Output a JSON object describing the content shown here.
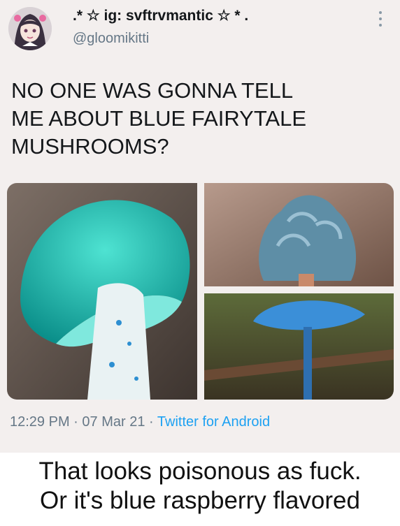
{
  "tweet": {
    "display_name": ".* ☆ ig: svftrvmantic ☆ * .",
    "handle": "@gloomikitti",
    "text": "NO ONE WAS GONNA TELL\nME ABOUT BLUE FAIRYTALE\nMUSHROOMS?",
    "time": "12:29 PM",
    "separator": "·",
    "date": "07 Mar 21",
    "source": "Twitter for Android",
    "images": [
      {
        "icon": "blue-mushroom-closeup-photo"
      },
      {
        "icon": "blue-mushroom-curled-cap-photo"
      },
      {
        "icon": "blue-mushroom-forest-photo"
      }
    ],
    "avatar_icon": "anime-avatar"
  },
  "caption": {
    "line1": "That looks poisonous as fuck.",
    "line2": "Or it's blue raspberry flavored"
  },
  "colors": {
    "background": "#f3efee",
    "link": "#1da1f2",
    "muted": "#657786",
    "text": "#14171a"
  }
}
